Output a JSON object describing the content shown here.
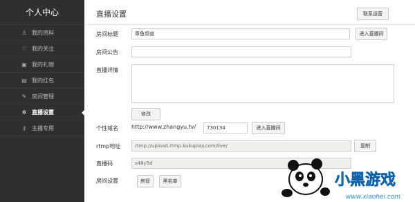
{
  "sidebar": {
    "title": "个人中心",
    "items": [
      {
        "label": "我的资料",
        "icon": "user-icon",
        "glyph": "♙"
      },
      {
        "label": "我的关注",
        "icon": "heart-icon",
        "glyph": "♡"
      },
      {
        "label": "我的礼物",
        "icon": "gift-icon",
        "glyph": "▣"
      },
      {
        "label": "我的红包",
        "icon": "envelope-icon",
        "glyph": "▤"
      },
      {
        "label": "房间管理",
        "icon": "wrench-icon",
        "glyph": "✎"
      },
      {
        "label": "直播设置",
        "icon": "gear-icon",
        "glyph": "✲"
      },
      {
        "label": "主播专用",
        "icon": "key-icon",
        "glyph": "⚷"
      }
    ],
    "active_index": 5
  },
  "header": {
    "title": "直播设置",
    "contact_button": "联系运营"
  },
  "form": {
    "room_title_label": "房间标题",
    "room_title_value": "章鱼频道",
    "enter_room_button": "进入直播间",
    "announcement_label": "房间公告",
    "announcement_value": "",
    "details_label": "直播详情",
    "modify_button": "修改",
    "domain_label": "个性域名",
    "domain_prefix": "http://www.zhangyu.tv/",
    "domain_value": "730134",
    "domain_enter_button": "进入直播间",
    "rtmp_label": "rtmp地址",
    "rtmp_value": "rtmp://upload.rtmp.kukuplay.com/live/",
    "copy_button": "复制",
    "code_label": "直播码",
    "code_value": "s48y5d",
    "room_settings_label": "房间设置",
    "room_admin_button": "房管",
    "blacklist_button": "黑名单"
  },
  "watermark": {
    "logo_text": "小黑游戏",
    "url": "www.xiaohei.com"
  },
  "colors": {
    "sidebar_bg": "#2f2f2f",
    "accent_blue": "#1f8ee6",
    "readonly_bg": "#f0f0ec"
  }
}
